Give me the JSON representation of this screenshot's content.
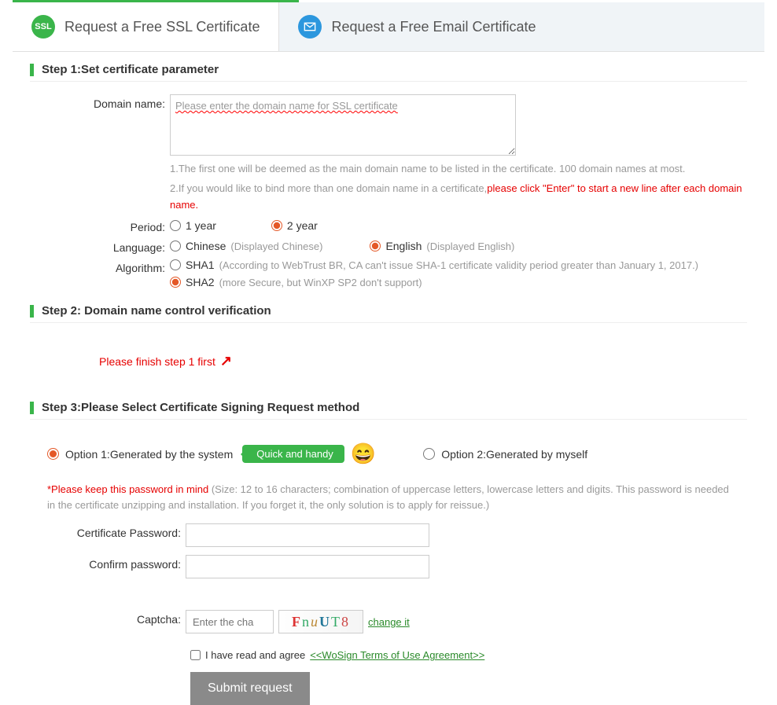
{
  "tabs": {
    "ssl": {
      "label": "Request a Free SSL Certificate",
      "icon_text": "SSL"
    },
    "email": {
      "label": "Request a Free Email Certificate"
    }
  },
  "step1": {
    "title": "Step 1:Set certificate parameter",
    "domain_label": "Domain name:",
    "domain_placeholder": "Please enter the domain name for SSL certificate",
    "hint1": "1.The first one will be deemed as the main domain name to be listed in the certificate. 100 domain names at most.",
    "hint2a": "2.If you would like to bind more than one domain name in a certificate,",
    "hint2b": "please click \"Enter\" to start a new line after each domain name.",
    "period_label": "Period:",
    "period_options": {
      "y1": "1 year",
      "y2": "2 year"
    },
    "period_selected": "y2",
    "language_label": "Language:",
    "language_options": {
      "chinese": {
        "label": "Chinese",
        "sub": "(Displayed Chinese)"
      },
      "english": {
        "label": "English",
        "sub": "(Displayed English)"
      }
    },
    "language_selected": "english",
    "algorithm_label": "Algorithm:",
    "algorithm_options": {
      "sha1": {
        "label": "SHA1",
        "sub": "(According to WebTrust BR, CA can't issue SHA-1 certificate validity period greater than January 1, 2017.)"
      },
      "sha2": {
        "label": "SHA2",
        "sub": "(more Secure, but WinXP SP2 don't support)"
      }
    },
    "algorithm_selected": "sha2"
  },
  "step2": {
    "title": "Step 2: Domain name control verification",
    "message": "Please finish step 1 first"
  },
  "step3": {
    "title": "Step 3:Please Select Certificate Signing Request method",
    "option1": "Option 1:Generated by the system",
    "option2": "Option 2:Generated by myself",
    "option_selected": "1",
    "quick_pill": "Quick and handy",
    "password_note_star": "*Please keep this password in mind ",
    "password_note_rest": "(Size: 12 to 16 characters; combination of uppercase letters, lowercase letters and digits. This password is needed in the certificate unzipping and installation. If you forget it, the only solution is to apply for reissue.)",
    "cert_password_label": "Certificate Password:",
    "confirm_password_label": "Confirm password:",
    "captcha_label": "Captcha:",
    "captcha_placeholder": "Enter the cha",
    "captcha_text": "FnuUT8",
    "change_link": "change it",
    "agree_text": "I have read and agree",
    "agree_link": "<<WoSign Terms of Use Agreement>>",
    "submit_label": "Submit request"
  }
}
